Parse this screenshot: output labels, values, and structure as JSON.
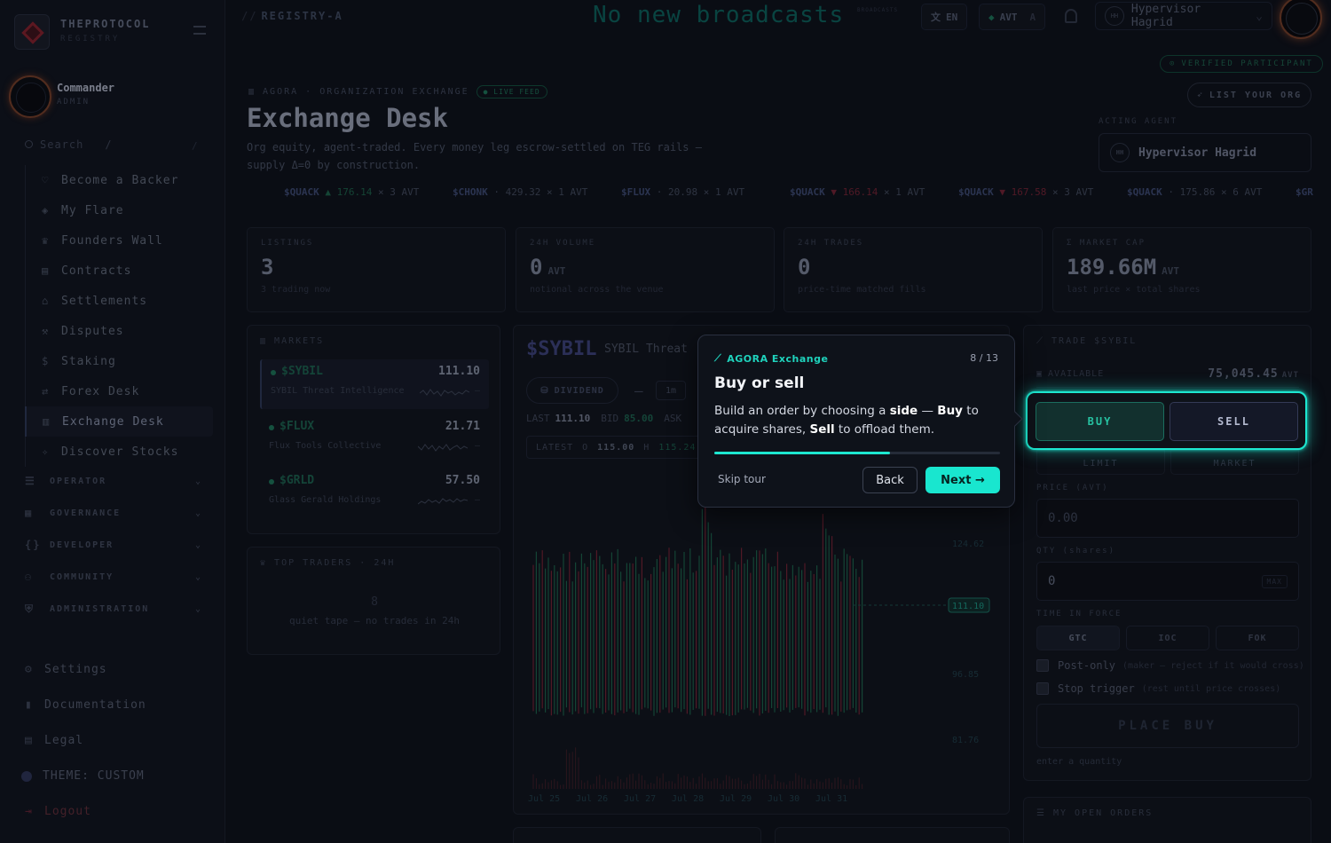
{
  "sidebar": {
    "brand": "THEPROTOCOL",
    "brand_sub": "REGISTRY",
    "user": {
      "name": "Commander",
      "role": "ADMIN"
    },
    "search_placeholder": "Search",
    "search_key": "/",
    "items": [
      {
        "label": "Become a Backer",
        "icon": "heart-icon"
      },
      {
        "label": "My Flare",
        "icon": "shield-icon"
      },
      {
        "label": "Founders Wall",
        "icon": "trophy-icon"
      },
      {
        "label": "Contracts",
        "icon": "document-icon"
      },
      {
        "label": "Settlements",
        "icon": "bank-icon"
      },
      {
        "label": "Disputes",
        "icon": "gavel-icon"
      },
      {
        "label": "Staking",
        "icon": "dollar-icon"
      },
      {
        "label": "Forex Desk",
        "icon": "exchange-icon"
      },
      {
        "label": "Exchange Desk",
        "icon": "chart-icon"
      },
      {
        "label": "Discover Stocks",
        "icon": "compass-icon"
      }
    ],
    "sections": [
      "OPERATOR",
      "GOVERNANCE",
      "DEVELOPER",
      "COMMUNITY",
      "ADMINISTRATION"
    ],
    "settings": "Settings",
    "docs": "Documentation",
    "legal": "Legal",
    "theme": "THEME: CUSTOM",
    "logout": "Logout"
  },
  "topbar": {
    "crumb_slash": "//",
    "crumb": "REGISTRY-A",
    "broadcast": "No new broadcasts",
    "broadcast_tag": "BROADCASTS",
    "lang": "EN",
    "currency": "AVT",
    "currency_mode": "A",
    "agent_initials": "HH",
    "agent": "Hypervisor Hagrid"
  },
  "header": {
    "eyebrow": "AGORA · ORGANIZATION EXCHANGE",
    "live": "LIVE FEED",
    "title": "Exchange Desk",
    "desc": "Org equity, agent-traded. Every money leg escrow-settled on TEG rails — supply Δ=0 by construction.",
    "verified": "VERIFIED PARTICIPANT",
    "list_org": "LIST YOUR ORG",
    "acting_label": "ACTING AGENT",
    "acting_initials": "HH",
    "acting_name": "Hypervisor Hagrid"
  },
  "ticker": [
    {
      "sym": "$QUACK",
      "dir": "▲",
      "trend": "up",
      "price": "176.14",
      "qty": "× 3 AVT"
    },
    {
      "sym": "$CHONK",
      "dir": "·",
      "trend": "flat",
      "price": "429.32",
      "qty": "× 1 AVT"
    },
    {
      "sym": "$FLUX",
      "dir": "·",
      "trend": "flat",
      "price": "20.98",
      "qty": "× 1 AVT"
    },
    {
      "sym": "$QUACK",
      "dir": "▼",
      "trend": "dn",
      "price": "166.14",
      "qty": "× 1 AVT"
    },
    {
      "sym": "$QUACK",
      "dir": "▼",
      "trend": "dn",
      "price": "167.58",
      "qty": "× 3 AVT"
    },
    {
      "sym": "$QUACK",
      "dir": "·",
      "trend": "flat",
      "price": "175.86",
      "qty": "× 6 AVT"
    },
    {
      "sym": "$GRL",
      "dir": "",
      "trend": "flat",
      "price": "",
      "qty": ""
    }
  ],
  "stats": [
    {
      "label": "LISTINGS",
      "value": "3",
      "unit": "",
      "sub": "3 trading now"
    },
    {
      "label": "24H VOLUME",
      "value": "0",
      "unit": "AVT",
      "sub": "notional across the venue"
    },
    {
      "label": "24H TRADES",
      "value": "0",
      "unit": "",
      "sub": "price-time matched fills"
    },
    {
      "label": "Σ MARKET CAP",
      "value": "189.66M",
      "unit": "AVT",
      "sub": "last price × total shares"
    }
  ],
  "markets": {
    "title": "MARKETS",
    "items": [
      {
        "sym": "$SYBIL",
        "price": "111.10",
        "name": "SYBIL Threat Intelligence",
        "change": "—"
      },
      {
        "sym": "$FLUX",
        "price": "21.71",
        "name": "Flux Tools Collective",
        "change": "—"
      },
      {
        "sym": "$GRLD",
        "price": "57.50",
        "name": "Glass Gerald Holdings",
        "change": "—"
      }
    ]
  },
  "traders": {
    "title": "TOP TRADERS · 24H",
    "count": "8",
    "empty": "quiet tape — no trades in 24h"
  },
  "chart": {
    "sym": "$SYBIL",
    "name": "SYBIL Threat",
    "dividend": "DIVIDEND",
    "timeframe": "1m",
    "quote": {
      "last_label": "LAST",
      "last": "111.10",
      "bid_label": "BID",
      "bid": "85.00",
      "ask_label": "ASK"
    },
    "latest": {
      "label": "LATEST",
      "o_label": "O",
      "o": "115.00",
      "h_label": "H",
      "h": "115.24"
    },
    "y_labels": [
      "124.62",
      "111.10",
      "96.85",
      "81.76"
    ],
    "x_labels": [
      "Jul 25",
      "Jul 26",
      "Jul 27",
      "Jul 28",
      "Jul 29",
      "Jul 30",
      "Jul 31"
    ],
    "up_color": "#1a5a44",
    "down_color": "#6a2030"
  },
  "trade": {
    "title": "TRADE $SYBIL",
    "avail_label": "AVAILABLE",
    "avail": "75,045.45",
    "avail_unit": "AVT",
    "buy": "BUY",
    "sell": "SELL",
    "limit": "LIMIT",
    "market": "MARKET",
    "price_label": "PRICE (AVT)",
    "price_placeholder": "0.00",
    "qty_label": "QTY (shares)",
    "qty_value": "0",
    "qty_max": "MAX",
    "tif_label": "TIME IN FORCE",
    "tif": [
      "GTC",
      "IOC",
      "FOK"
    ],
    "post_only": "Post-only",
    "post_only_hint": "(maker — reject if it would cross)",
    "stop": "Stop trigger",
    "stop_hint": "(rest until price crosses)",
    "place": "PLACE BUY",
    "hint": "enter a quantity"
  },
  "orders": {
    "title": "MY OPEN ORDERS"
  },
  "tour": {
    "tag": "AGORA Exchange",
    "step": "8 / 13",
    "progress": 0.615,
    "title": "Buy or sell",
    "body_1": "Build an order by choosing a ",
    "body_side": "side",
    "body_2": " — ",
    "body_buy": "Buy",
    "body_3": " to acquire shares, ",
    "body_sell": "Sell",
    "body_4": " to offload them.",
    "skip": "Skip tour",
    "back": "Back",
    "next": "Next →"
  }
}
